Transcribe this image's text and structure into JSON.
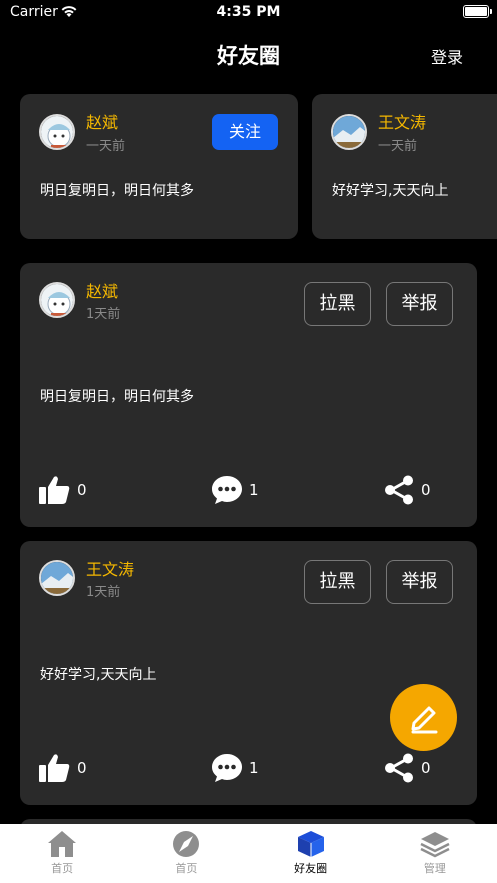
{
  "status_bar": {
    "carrier": "Carrier",
    "time": "4:35 PM"
  },
  "nav": {
    "title": "好友圈",
    "login": "登录"
  },
  "featured": [
    {
      "name": "赵斌",
      "time": "一天前",
      "content": "明日复明日，明日何其多",
      "follow": "关注"
    },
    {
      "name": "王文涛",
      "time": "一天前",
      "content": "好好学习,天天向上"
    }
  ],
  "posts": [
    {
      "name": "赵斌",
      "time": "1天前",
      "content": "明日复明日，明日何其多",
      "block": "拉黑",
      "report": "举报",
      "likes": "0",
      "comments": "1",
      "shares": "0"
    },
    {
      "name": "王文涛",
      "time": "1天前",
      "content": "好好学习,天天向上",
      "block": "拉黑",
      "report": "举报",
      "likes": "0",
      "comments": "1",
      "shares": "0"
    }
  ],
  "tabs": [
    {
      "label": "首页",
      "icon": "home-icon"
    },
    {
      "label": "首页",
      "icon": "compass-icon"
    },
    {
      "label": "好友圈",
      "icon": "cube-icon",
      "active": true
    },
    {
      "label": "管理",
      "icon": "layers-icon"
    }
  ],
  "colors": {
    "accent": "#f5b800",
    "follow": "#1463f3",
    "fab": "#f5a700",
    "card": "#2a2a2a"
  }
}
